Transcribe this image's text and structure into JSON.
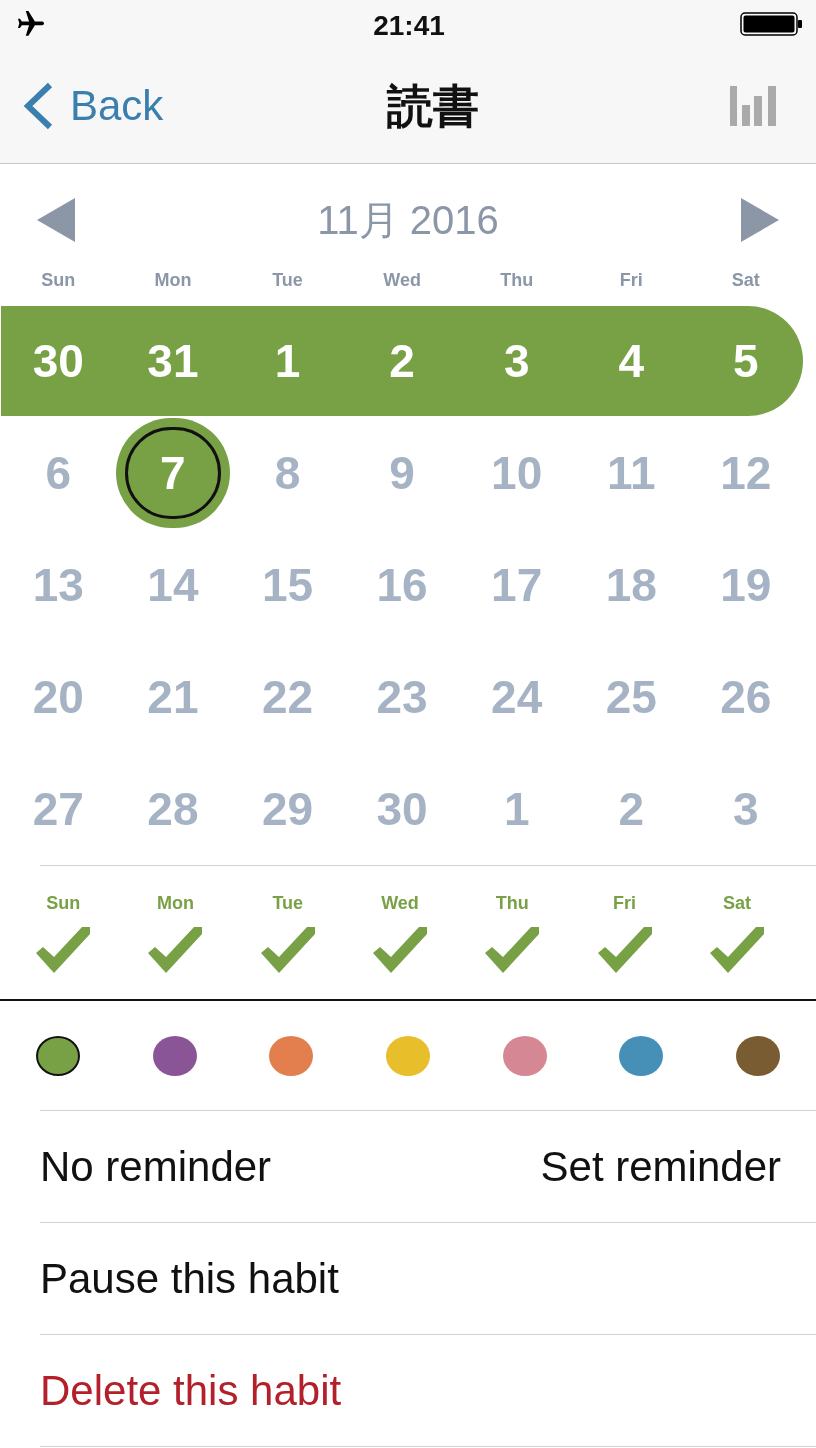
{
  "status_bar": {
    "time": "21:41"
  },
  "nav": {
    "back": "Back",
    "title": "読書"
  },
  "calendar": {
    "month_title": "11月 2016",
    "weekdays": [
      "Sun",
      "Mon",
      "Tue",
      "Wed",
      "Thu",
      "Fri",
      "Sat"
    ],
    "weeks": [
      {
        "days": [
          {
            "label": "30",
            "done": true,
            "selected": false
          },
          {
            "label": "31",
            "done": true,
            "selected": false
          },
          {
            "label": "1",
            "done": true,
            "selected": false
          },
          {
            "label": "2",
            "done": true,
            "selected": false
          },
          {
            "label": "3",
            "done": true,
            "selected": false
          },
          {
            "label": "4",
            "done": true,
            "selected": false
          },
          {
            "label": "5",
            "done": true,
            "selected": false
          }
        ]
      },
      {
        "days": [
          {
            "label": "6",
            "done": false,
            "selected": false
          },
          {
            "label": "7",
            "done": true,
            "selected": true
          },
          {
            "label": "8",
            "done": false,
            "selected": false
          },
          {
            "label": "9",
            "done": false,
            "selected": false
          },
          {
            "label": "10",
            "done": false,
            "selected": false
          },
          {
            "label": "11",
            "done": false,
            "selected": false
          },
          {
            "label": "12",
            "done": false,
            "selected": false
          }
        ]
      },
      {
        "days": [
          {
            "label": "13",
            "done": false,
            "selected": false
          },
          {
            "label": "14",
            "done": false,
            "selected": false
          },
          {
            "label": "15",
            "done": false,
            "selected": false
          },
          {
            "label": "16",
            "done": false,
            "selected": false
          },
          {
            "label": "17",
            "done": false,
            "selected": false
          },
          {
            "label": "18",
            "done": false,
            "selected": false
          },
          {
            "label": "19",
            "done": false,
            "selected": false
          }
        ]
      },
      {
        "days": [
          {
            "label": "20",
            "done": false,
            "selected": false
          },
          {
            "label": "21",
            "done": false,
            "selected": false
          },
          {
            "label": "22",
            "done": false,
            "selected": false
          },
          {
            "label": "23",
            "done": false,
            "selected": false
          },
          {
            "label": "24",
            "done": false,
            "selected": false
          },
          {
            "label": "25",
            "done": false,
            "selected": false
          },
          {
            "label": "26",
            "done": false,
            "selected": false
          }
        ]
      },
      {
        "days": [
          {
            "label": "27",
            "done": false,
            "selected": false
          },
          {
            "label": "28",
            "done": false,
            "selected": false
          },
          {
            "label": "29",
            "done": false,
            "selected": false
          },
          {
            "label": "30",
            "done": false,
            "selected": false
          },
          {
            "label": "1",
            "done": false,
            "selected": false
          },
          {
            "label": "2",
            "done": false,
            "selected": false
          },
          {
            "label": "3",
            "done": false,
            "selected": false
          }
        ]
      }
    ]
  },
  "schedule": {
    "days": [
      {
        "label": "Sun",
        "checked": true
      },
      {
        "label": "Mon",
        "checked": true
      },
      {
        "label": "Tue",
        "checked": true
      },
      {
        "label": "Wed",
        "checked": true
      },
      {
        "label": "Thu",
        "checked": true
      },
      {
        "label": "Fri",
        "checked": true
      },
      {
        "label": "Sat",
        "checked": true
      }
    ]
  },
  "colors": [
    {
      "color": "#78a146",
      "selected": true
    },
    {
      "color": "#8a5597",
      "selected": false
    },
    {
      "color": "#e37f4f",
      "selected": false
    },
    {
      "color": "#e8bf2b",
      "selected": false
    },
    {
      "color": "#d58894",
      "selected": false
    },
    {
      "color": "#4690b8",
      "selected": false
    },
    {
      "color": "#7a5c33",
      "selected": false
    }
  ],
  "reminder": {
    "label": "No reminder",
    "action": "Set reminder"
  },
  "actions": [
    {
      "label": "Pause this habit",
      "kind": "normal"
    },
    {
      "label": "Delete this habit",
      "kind": "destructive"
    }
  ]
}
